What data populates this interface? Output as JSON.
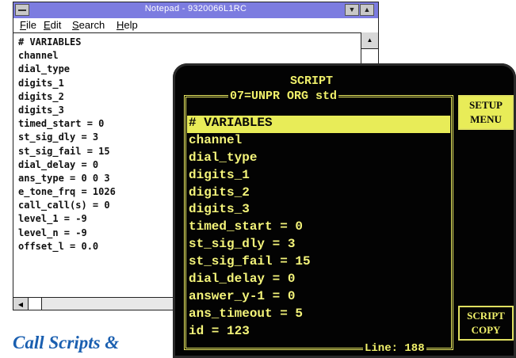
{
  "notepad": {
    "title": "Notepad - 9320066L1RC",
    "menus": [
      "File",
      "Edit",
      "Search",
      "Help"
    ],
    "lines": [
      "# VARIABLES",
      "channel",
      "dial_type",
      "digits_1",
      "digits_2",
      "digits_3",
      "timed_start = 0",
      "st_sig_dly = 3",
      "st_sig_fail = 15",
      "dial_delay = 0",
      "ans_type = 0 0 3",
      "e_tone_frq = 1026",
      "call_call(s) = 0",
      "level_1 = -9",
      "level_n = -9",
      "offset_l = 0.0"
    ],
    "min_glyph": "▼",
    "max_glyph": "▲",
    "scroll_up_glyph": "▲",
    "scroll_left_glyph": "◀"
  },
  "terminal": {
    "title": "SCRIPT",
    "subtitle": "07=UNPR ORG std",
    "lines": [
      "# VARIABLES",
      "channel",
      "dial_type",
      "digits_1",
      "digits_2",
      "digits_3",
      "timed_start = 0",
      "st_sig_dly = 3",
      "st_sig_fail = 15",
      "dial_delay = 0",
      "answer_y-1 = 0",
      "ans_timeout = 5",
      "id = 123"
    ],
    "selected_index": 0,
    "status": "Line: 188",
    "setup_button": [
      "SETUP",
      "MENU"
    ],
    "copy_button": [
      "SCRIPT",
      "COPY"
    ]
  },
  "caption": "Call Scripts &",
  "colors": {
    "terminal_text": "#f4f47a",
    "terminal_bg": "#030303",
    "notepad_titlebar": "#7c7ce0",
    "caption": "#1a5fb0"
  }
}
